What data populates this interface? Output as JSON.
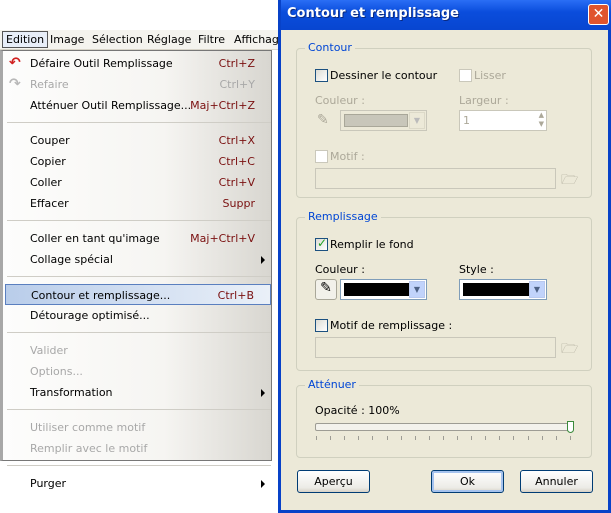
{
  "menubar": {
    "items": [
      "Edition",
      "Image",
      "Sélection",
      "Réglage",
      "Filtre",
      "Affichag"
    ]
  },
  "menu": {
    "entries": [
      {
        "label": "Défaire Outil Remplissage",
        "shortcut": "Ctrl+Z",
        "icon": "undo-icon"
      },
      {
        "label": "Refaire",
        "shortcut": "Ctrl+Y",
        "disabled": true,
        "icon": "redo-icon"
      },
      {
        "label": "Atténuer Outil Remplissage...",
        "shortcut": "Maj+Ctrl+Z"
      },
      {
        "sep": true
      },
      {
        "label": "Couper",
        "shortcut": "Ctrl+X"
      },
      {
        "label": "Copier",
        "shortcut": "Ctrl+C"
      },
      {
        "label": "Coller",
        "shortcut": "Ctrl+V"
      },
      {
        "label": "Effacer",
        "shortcut": "Suppr"
      },
      {
        "sep": true
      },
      {
        "label": "Coller en tant qu'image",
        "shortcut": "Maj+Ctrl+V"
      },
      {
        "label": "Collage spécial",
        "submenu": true
      },
      {
        "sep": true
      },
      {
        "label": "Contour et remplissage...",
        "shortcut": "Ctrl+B",
        "highlighted": true
      },
      {
        "label": "Détourage optimisé..."
      },
      {
        "sep": true
      },
      {
        "label": "Valider",
        "disabled": true
      },
      {
        "label": "Options...",
        "disabled": true
      },
      {
        "label": "Transformation",
        "submenu": true
      },
      {
        "sep": true
      },
      {
        "label": "Utiliser comme motif",
        "disabled": true
      },
      {
        "label": "Remplir avec le motif",
        "disabled": true
      },
      {
        "sep": true
      },
      {
        "label": "Purger",
        "submenu": true
      }
    ]
  },
  "dialog": {
    "title": "Contour et remplissage",
    "contour": {
      "title": "Contour",
      "draw_label": "Dessiner le contour",
      "draw_checked": false,
      "smooth_label": "Lisser",
      "smooth_checked": false,
      "color_label": "Couleur :",
      "width_label": "Largeur :",
      "width_value": "1",
      "pattern_label": "Motif :",
      "pattern_value": ""
    },
    "fill": {
      "title": "Remplissage",
      "fill_label": "Remplir le fond",
      "fill_checked": true,
      "color_label": "Couleur :",
      "color_value": "#000000",
      "style_label": "Style :",
      "pattern_label": "Motif de remplissage :",
      "pattern_checked": false,
      "pattern_value": ""
    },
    "fade": {
      "title": "Atténuer",
      "opacity_label": "Opacité : 100%",
      "opacity_percent": 100
    },
    "buttons": {
      "preview": "Aperçu",
      "ok": "Ok",
      "cancel": "Annuler"
    }
  }
}
